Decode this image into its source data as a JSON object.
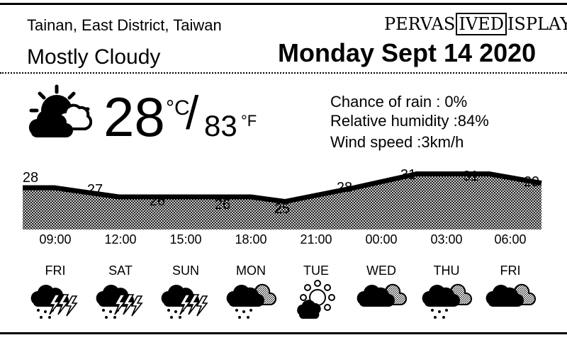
{
  "location": "Tainan, East District, Taiwan",
  "condition": "Mostly Cloudy",
  "brand": {
    "part1": "PERVAS",
    "part2": "IVED",
    "part3": "ISPLAYS"
  },
  "date": "Monday Sept 14 2020",
  "current": {
    "temp_c": "28",
    "unit_c": "°C",
    "slash": "/",
    "temp_f": "83",
    "unit_f": "°F",
    "icon": "partly-cloudy-night-icon"
  },
  "stats": {
    "rain": "Chance of rain : 0%",
    "humidity": "Relative humidity :84%",
    "wind": "Wind speed :3km/h"
  },
  "hourly": [
    {
      "time": "09:00",
      "temp": 28
    },
    {
      "time": "12:00",
      "temp": 27
    },
    {
      "time": "15:00",
      "temp": 26
    },
    {
      "time": "18:00",
      "temp": 26
    },
    {
      "time": "21:00",
      "temp": 25
    },
    {
      "time": "00:00",
      "temp": 28
    },
    {
      "time": "03:00",
      "temp": 31
    },
    {
      "time": "06:00",
      "temp": 31
    },
    {
      "time": "",
      "temp": 29
    }
  ],
  "daily": [
    {
      "day": "FRI",
      "icon": "thunderstorm-icon"
    },
    {
      "day": "SAT",
      "icon": "thunderstorm-icon"
    },
    {
      "day": "SUN",
      "icon": "thunderstorm-icon"
    },
    {
      "day": "MON",
      "icon": "rain-icon"
    },
    {
      "day": "TUE",
      "icon": "partly-cloudy-icon"
    },
    {
      "day": "WED",
      "icon": "cloudy-icon"
    },
    {
      "day": "THU",
      "icon": "rain-icon"
    },
    {
      "day": "FRI",
      "icon": "cloudy-icon"
    }
  ]
}
